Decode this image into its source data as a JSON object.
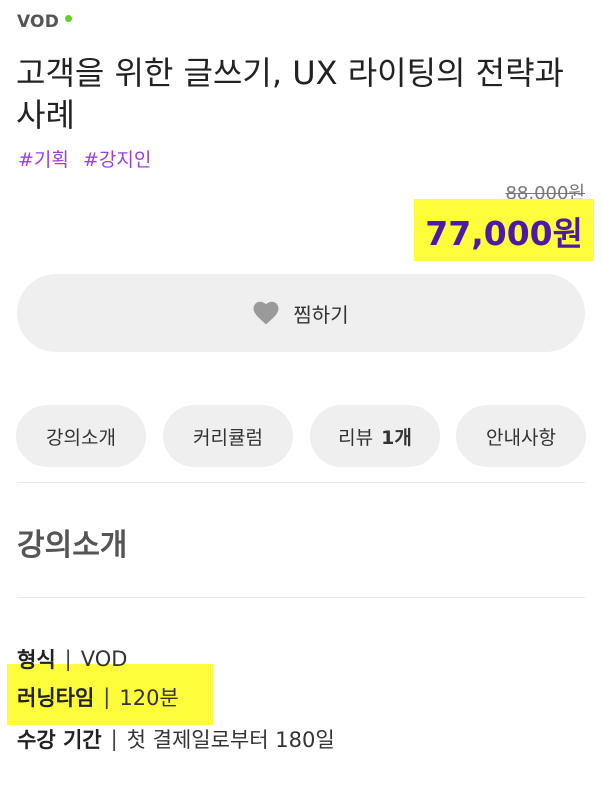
{
  "product": {
    "format_badge": "VOD",
    "title": "고객을 위한 글쓰기, UX 라이팅의 전략과 사례",
    "tags": [
      "#기획",
      "#강지인"
    ],
    "original_price": "88,000원",
    "price": "77,000원"
  },
  "actions": {
    "wishlist_label": "찜하기"
  },
  "tabs": [
    {
      "label": "강의소개",
      "count": ""
    },
    {
      "label": "커리큘럼",
      "count": ""
    },
    {
      "label": "리뷰",
      "count": "1개"
    },
    {
      "label": "안내사항",
      "count": ""
    }
  ],
  "section": {
    "title": "강의소개"
  },
  "info": [
    {
      "key": "형식",
      "value": "VOD"
    },
    {
      "key": "러닝타임",
      "value": "120분"
    },
    {
      "key": "수강 기간",
      "value": "첫 결제일로부터 180일"
    }
  ],
  "colors": {
    "tag": "#9b3fe0",
    "price": "#4b1aa6",
    "live_dot": "#5ed12a",
    "highlight": "#fdfd3c",
    "button_bg": "#efefef"
  },
  "icons": {
    "wishlist": "heart-icon",
    "status": "live-dot-icon"
  }
}
